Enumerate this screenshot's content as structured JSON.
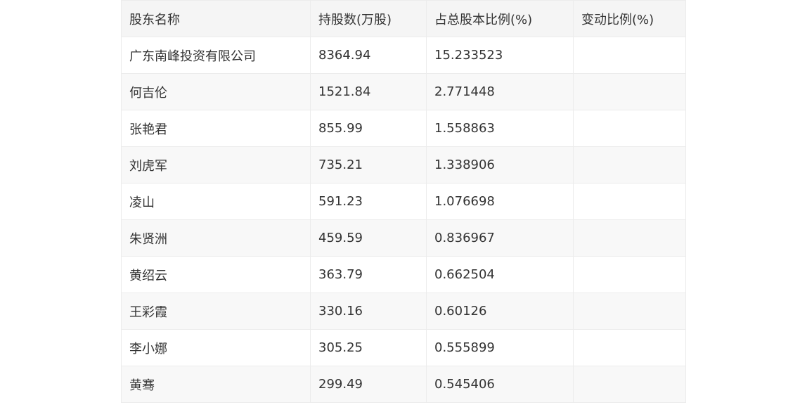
{
  "table": {
    "headers": [
      "股东名称",
      "持股数(万股)",
      "占总股本比例(%)",
      "变动比例(%)"
    ],
    "rows": [
      [
        "广东南峰投资有限公司",
        "8364.94",
        "15.233523",
        ""
      ],
      [
        "何吉伦",
        "1521.84",
        "2.771448",
        ""
      ],
      [
        "张艳君",
        "855.99",
        "1.558863",
        ""
      ],
      [
        "刘虎军",
        "735.21",
        "1.338906",
        ""
      ],
      [
        "凌山",
        "591.23",
        "1.076698",
        ""
      ],
      [
        "朱贤洲",
        "459.59",
        "0.836967",
        ""
      ],
      [
        "黄绍云",
        "363.79",
        "0.662504",
        ""
      ],
      [
        "王彩霞",
        "330.16",
        "0.60126",
        ""
      ],
      [
        "李小娜",
        "305.25",
        "0.555899",
        ""
      ],
      [
        "黄骞",
        "299.49",
        "0.545406",
        ""
      ]
    ]
  }
}
